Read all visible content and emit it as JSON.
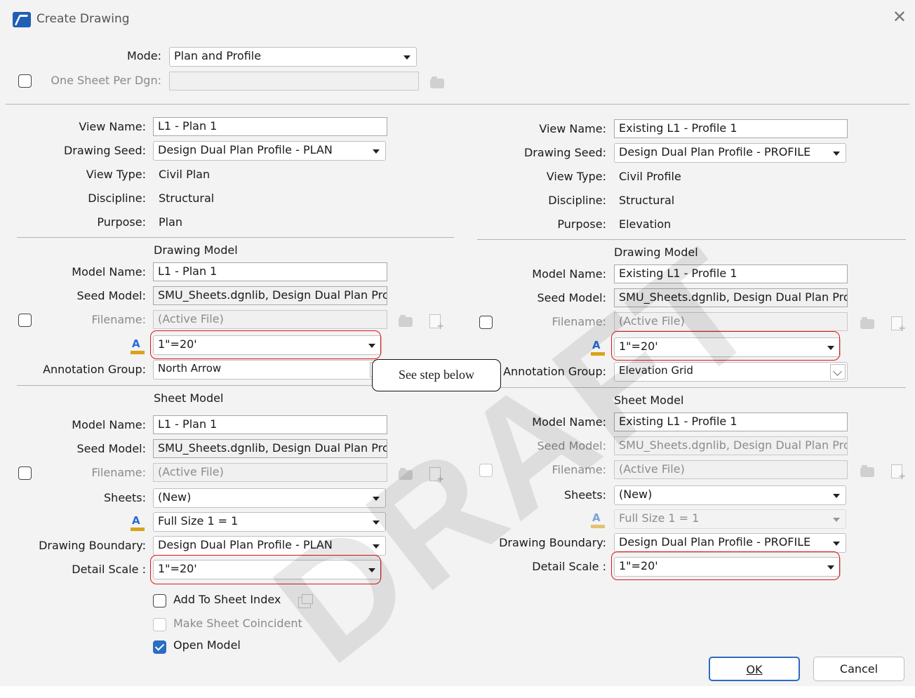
{
  "window": {
    "title": "Create Drawing",
    "close_glyph": "✕"
  },
  "mode": {
    "label": "Mode:",
    "value": "Plan and Profile"
  },
  "one_sheet": {
    "label": "One Sheet Per Dgn:",
    "value": ""
  },
  "left": {
    "view_name_label": "View Name:",
    "view_name": "L1 - Plan 1",
    "drawing_seed_label": "Drawing Seed:",
    "drawing_seed": "Design Dual Plan Profile - PLAN",
    "view_type_label": "View Type:",
    "view_type": "Civil Plan",
    "discipline_label": "Discipline:",
    "discipline": "Structural",
    "purpose_label": "Purpose:",
    "purpose": "Plan",
    "drawing_model": {
      "heading": "Drawing Model",
      "model_name_label": "Model Name:",
      "model_name": "L1 - Plan 1",
      "seed_model_label": "Seed Model:",
      "seed_model": "SMU_Sheets.dgnlib, Design Dual Plan Prc",
      "filename_label": "Filename:",
      "filename": "(Active File)",
      "scale": "1\"=20'",
      "annotation_group_label": "Annotation Group:",
      "annotation_group": "North Arrow"
    },
    "sheet_model": {
      "heading": "Sheet Model",
      "model_name_label": "Model Name:",
      "model_name": "L1 - Plan 1",
      "seed_model_label": "Seed Model:",
      "seed_model": "SMU_Sheets.dgnlib, Design Dual Plan Prc",
      "filename_label": "Filename:",
      "filename": "(Active File)",
      "sheets_label": "Sheets:",
      "sheets": "(New)",
      "sheet_size": "Full Size 1 = 1",
      "drawing_boundary_label": "Drawing Boundary:",
      "drawing_boundary": "Design Dual Plan Profile - PLAN",
      "detail_scale_label": "Detail Scale :",
      "detail_scale": "1\"=20'"
    }
  },
  "right": {
    "view_name_label": "View Name:",
    "view_name": "Existing L1 - Profile 1",
    "drawing_seed_label": "Drawing Seed:",
    "drawing_seed": "Design Dual Plan Profile - PROFILE",
    "view_type_label": "View Type:",
    "view_type": "Civil Profile",
    "discipline_label": "Discipline:",
    "discipline": "Structural",
    "purpose_label": "Purpose:",
    "purpose": "Elevation",
    "drawing_model": {
      "heading": "Drawing Model",
      "model_name_label": "Model Name:",
      "model_name": "Existing L1 - Profile 1",
      "seed_model_label": "Seed Model:",
      "seed_model": "SMU_Sheets.dgnlib, Design Dual Plan Prc",
      "filename_label": "Filename:",
      "filename": "(Active File)",
      "scale": "1\"=20'",
      "annotation_group_label": "Annotation Group:",
      "annotation_group": "Elevation Grid"
    },
    "sheet_model": {
      "heading": "Sheet Model",
      "model_name_label": "Model Name:",
      "model_name": "Existing L1 - Profile 1",
      "seed_model_label": "Seed Model:",
      "seed_model": "SMU_Sheets.dgnlib, Design Dual Plan Prc",
      "filename_label": "Filename:",
      "filename": "(Active File)",
      "sheets_label": "Sheets:",
      "sheets": "(New)",
      "sheet_size": "Full Size 1 = 1",
      "drawing_boundary_label": "Drawing Boundary:",
      "drawing_boundary": "Design Dual Plan Profile - PROFILE",
      "detail_scale_label": "Detail Scale :",
      "detail_scale": "1\"=20'"
    }
  },
  "options": {
    "add_to_sheet_index": "Add To Sheet Index",
    "make_sheet_coincident": "Make Sheet Coincident",
    "open_model": "Open Model"
  },
  "buttons": {
    "ok": "OK",
    "cancel": "Cancel"
  },
  "callout": "See step below",
  "watermark": "DRAFT",
  "colors": {
    "accent": "#2b6cc4",
    "highlight": "#e0161a",
    "background": "#f3f3f3"
  }
}
